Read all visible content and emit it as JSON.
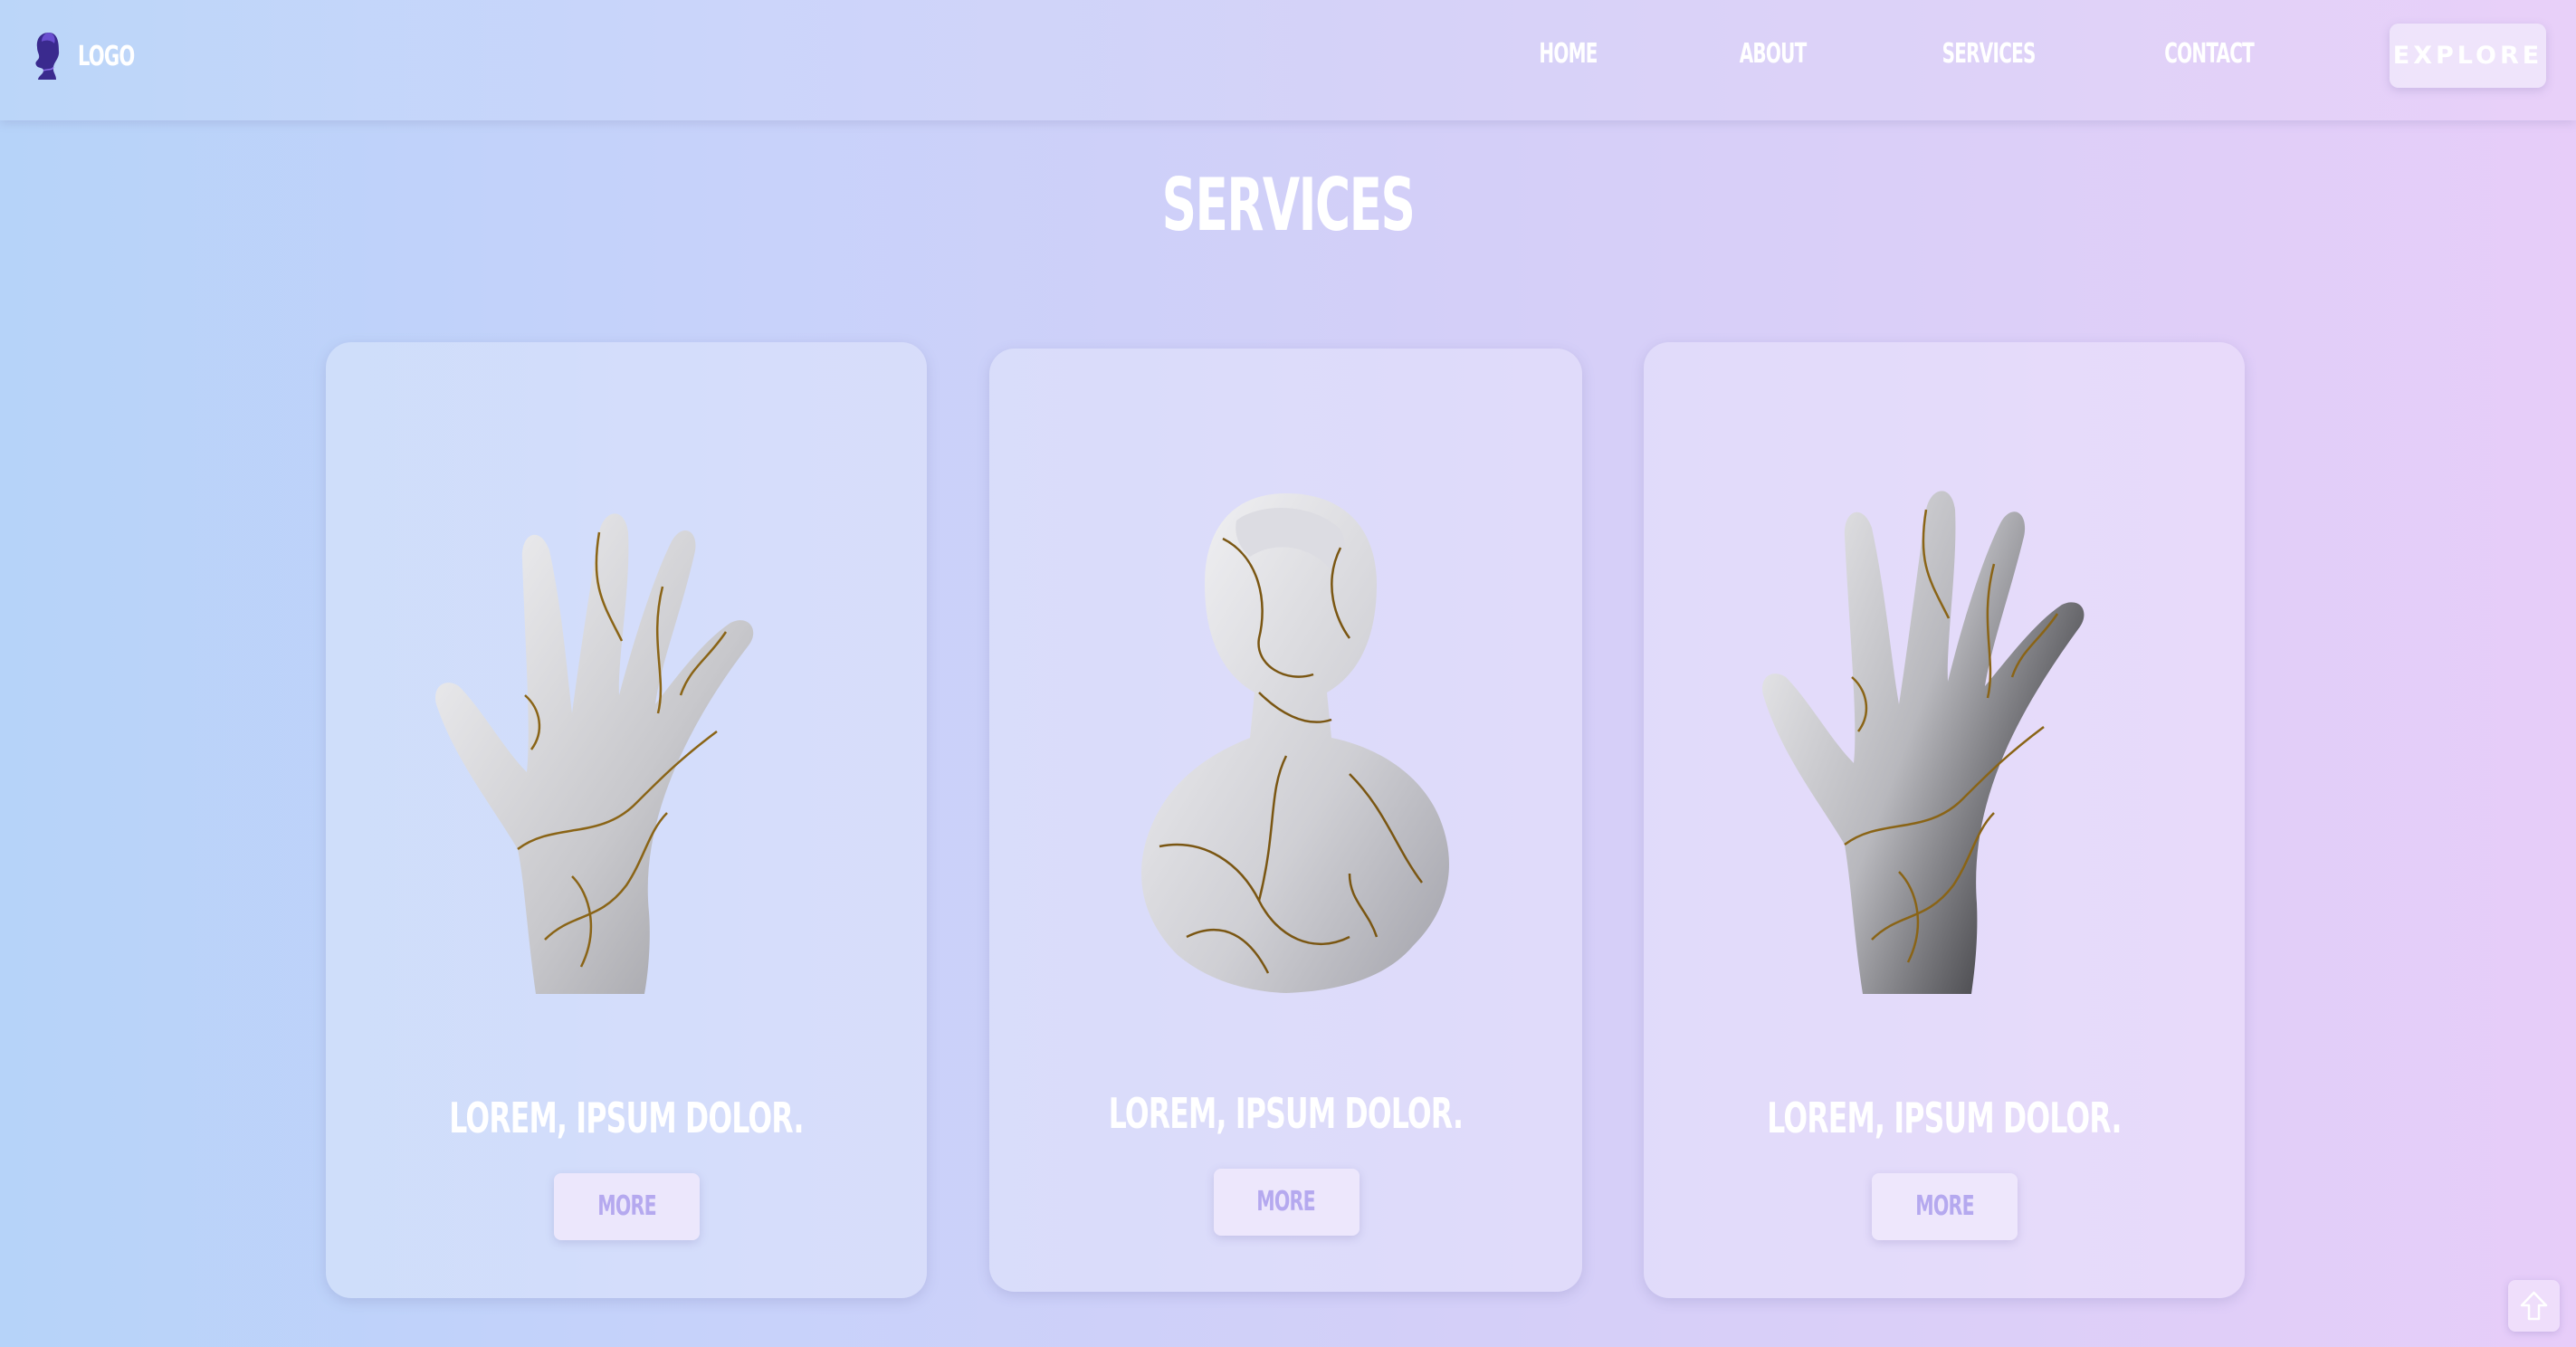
{
  "navbar": {
    "logo_text": "LOGO",
    "links": [
      {
        "label": "HOME"
      },
      {
        "label": "ABOUT"
      },
      {
        "label": "SERVICES"
      },
      {
        "label": "CONTACT"
      }
    ],
    "cta_label": "EXPLORE"
  },
  "main": {
    "title": "SERVICES",
    "cards": [
      {
        "title": "LOREM, IPSUM DOLOR.",
        "button_label": "MORE",
        "image_icon": "marble-hand-icon"
      },
      {
        "title": "LOREM, IPSUM DOLOR.",
        "button_label": "MORE",
        "image_icon": "marble-bust-icon"
      },
      {
        "title": "LOREM, IPSUM DOLOR.",
        "button_label": "MORE",
        "image_icon": "marble-hand-icon"
      }
    ]
  },
  "scroll_top": {
    "icon": "arrow-up-icon"
  },
  "colors": {
    "gradient_start": "#b6d3f9",
    "gradient_end": "#e7cdf9",
    "button_text": "#b5a9ef",
    "crack_gold": "#a07a1a"
  }
}
